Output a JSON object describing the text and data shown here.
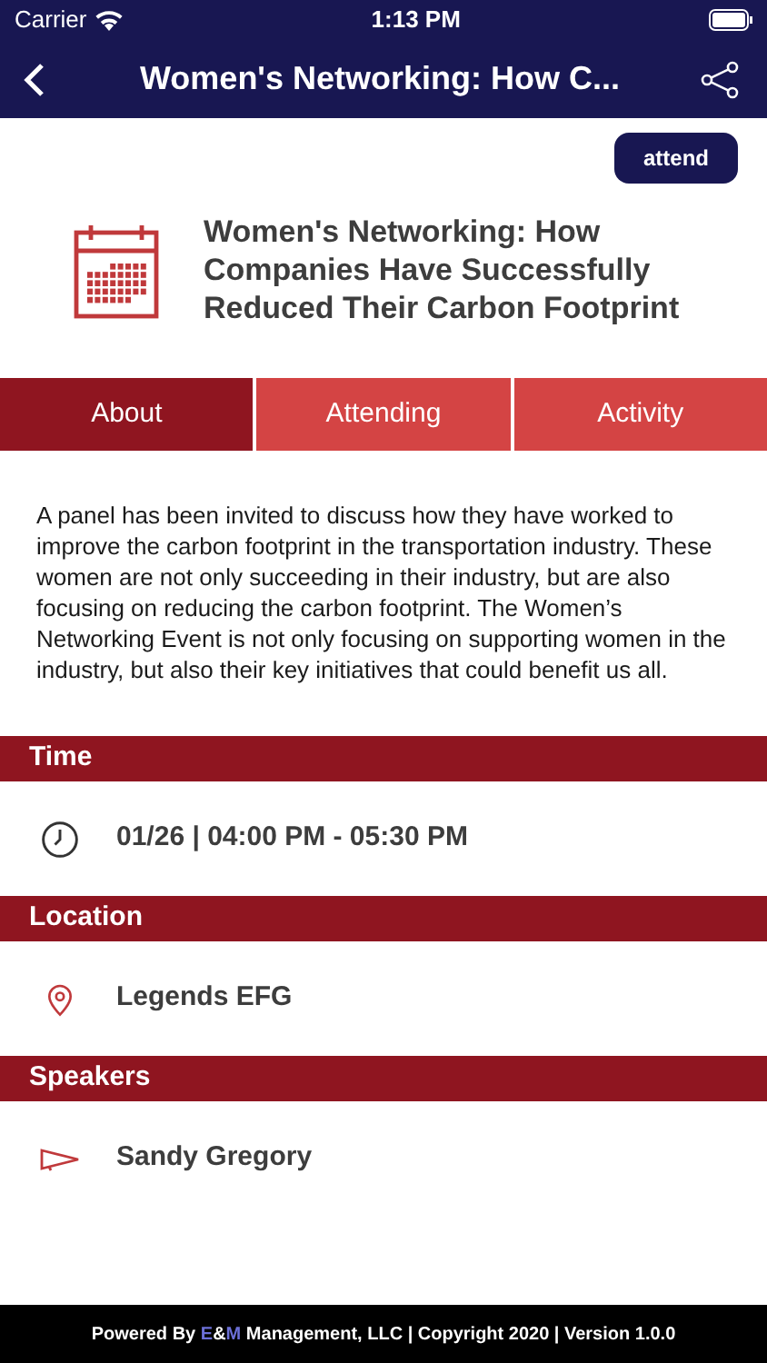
{
  "status_bar": {
    "carrier": "Carrier",
    "time": "1:13 PM"
  },
  "nav": {
    "title": "Women's Networking: How C..."
  },
  "attend_button": "attend",
  "event": {
    "title": "Women's Networking: How Companies Have Successfully Reduced Their Carbon Footprint"
  },
  "tabs": [
    {
      "label": "About",
      "selected": true
    },
    {
      "label": "Attending",
      "selected": false
    },
    {
      "label": "Activity",
      "selected": false
    }
  ],
  "description": "A panel has been invited to discuss how they have worked to improve the carbon footprint in the transportation industry. These women are not only succeeding in their industry, but are also focusing on reducing the carbon footprint. The Women’s Networking Event is not only focusing on supporting women in the industry, but also their key initiatives that could benefit us all.",
  "sections": [
    {
      "title": "Time",
      "items": [
        {
          "kind": "time",
          "text": "01/26 | 04:00 PM - 05:30 PM"
        }
      ]
    },
    {
      "title": "Location",
      "items": [
        {
          "kind": "location",
          "text": "Legends EFG"
        }
      ]
    },
    {
      "title": "Speakers",
      "items": [
        {
          "kind": "speaker",
          "text": "Sandy Gregory"
        }
      ]
    }
  ],
  "footer": {
    "prefix": "Powered By",
    "brand": [
      "E",
      "&",
      "M"
    ],
    "suffix": "Management, LLC | Copyright 2020 | Version 1.0.0"
  }
}
